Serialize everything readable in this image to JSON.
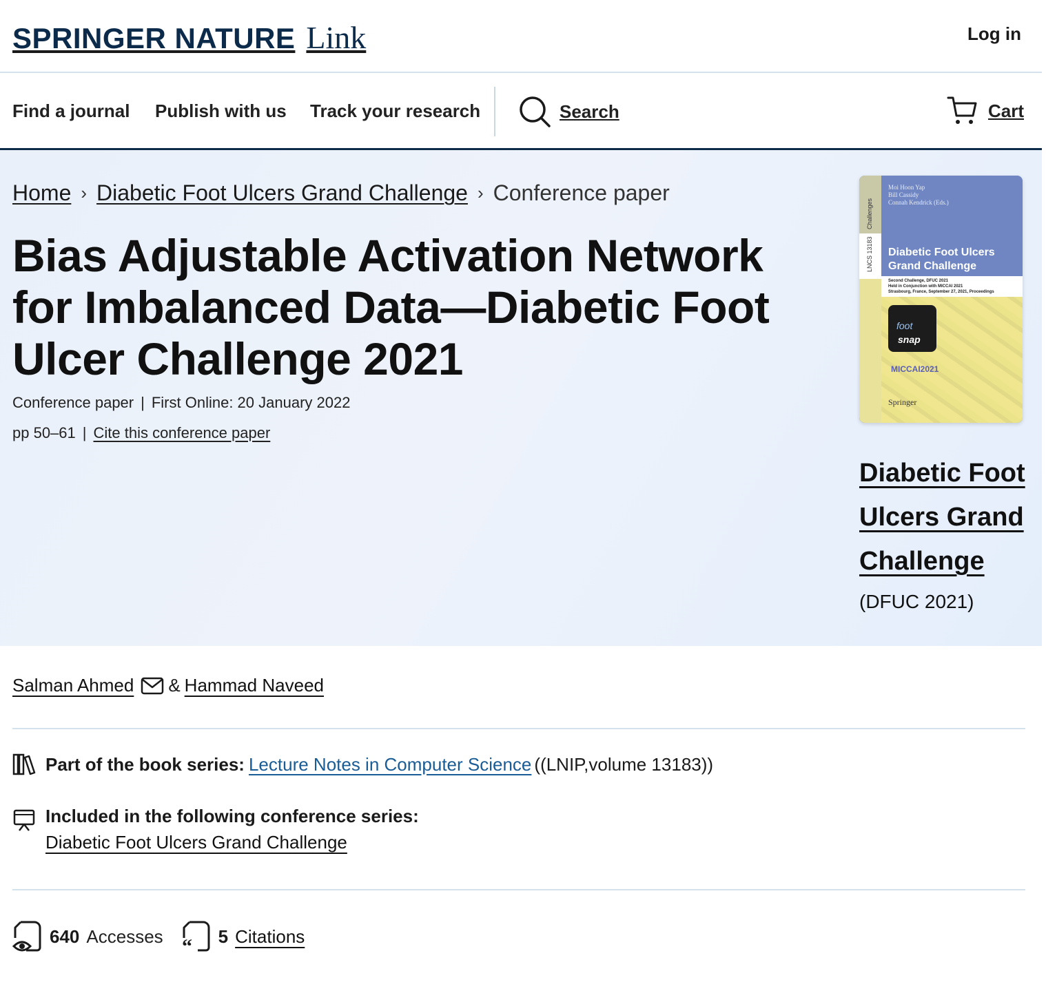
{
  "header": {
    "brand": "SPRINGER NATURE",
    "brand_suffix": "Link",
    "login_label": "Log in"
  },
  "nav": {
    "items": [
      {
        "label": "Find a journal"
      },
      {
        "label": "Publish with us"
      },
      {
        "label": "Track your research"
      }
    ],
    "search_label": "Search",
    "cart_label": "Cart",
    "icons": {
      "search": "search-icon",
      "cart": "cart-icon"
    }
  },
  "breadcrumb": {
    "items": [
      {
        "label": "Home"
      },
      {
        "label": "Diabetic Foot Ulcers Grand Challenge"
      }
    ],
    "current": "Conference paper"
  },
  "article": {
    "title": "Bias Adjustable Activation Network for Imbalanced Data—Diabetic Foot Ulcer Challenge 2021",
    "type": "Conference paper",
    "first_online": "First Online: 20 January 2022",
    "pages": "pp 50–61",
    "cite_label": "Cite this conference paper"
  },
  "book": {
    "cover": {
      "editors": [
        "Moi Hoon Yap",
        "Bill Cassidy",
        "Connah Kendrick (Eds.)"
      ],
      "spine_series": "Challenges",
      "spine_lncs": "LNCS 13183",
      "title_lines": [
        "Diabetic Foot Ulcers",
        "Grand Challenge"
      ],
      "subtitle_lines": [
        "Second Challenge, DFUC 2021",
        "Held in Conjunction with MICCAI 2021",
        "Strasbourg, France, September 27, 2021, Proceedings"
      ],
      "logo_line1": "foot",
      "logo_line2": "snap",
      "event": "MICCAI2021",
      "publisher": "Springer"
    },
    "link_label": "Diabetic Foot Ulcers Grand Challenge",
    "subtitle": "(DFUC 2021)"
  },
  "authors": {
    "items": [
      {
        "name": "Salman Ahmed"
      },
      {
        "name": "Hammad Naveed"
      }
    ],
    "separator": "&"
  },
  "series": {
    "label": "Part of the book series:",
    "link": "Lecture Notes in Computer Science",
    "extra": "((LNIP,volume 13183))"
  },
  "conference": {
    "label": "Included in the following conference series:",
    "link": "Diabetic Foot Ulcers Grand Challenge"
  },
  "metrics": {
    "accesses_count": "640",
    "accesses_label": "Accesses",
    "citations_count": "5",
    "citations_label": "Citations"
  },
  "colors": {
    "brand": "#0c2a4a",
    "link": "#1a5c96",
    "hero_bg": "#e9f0f9",
    "rule": "#d3e2ec"
  }
}
